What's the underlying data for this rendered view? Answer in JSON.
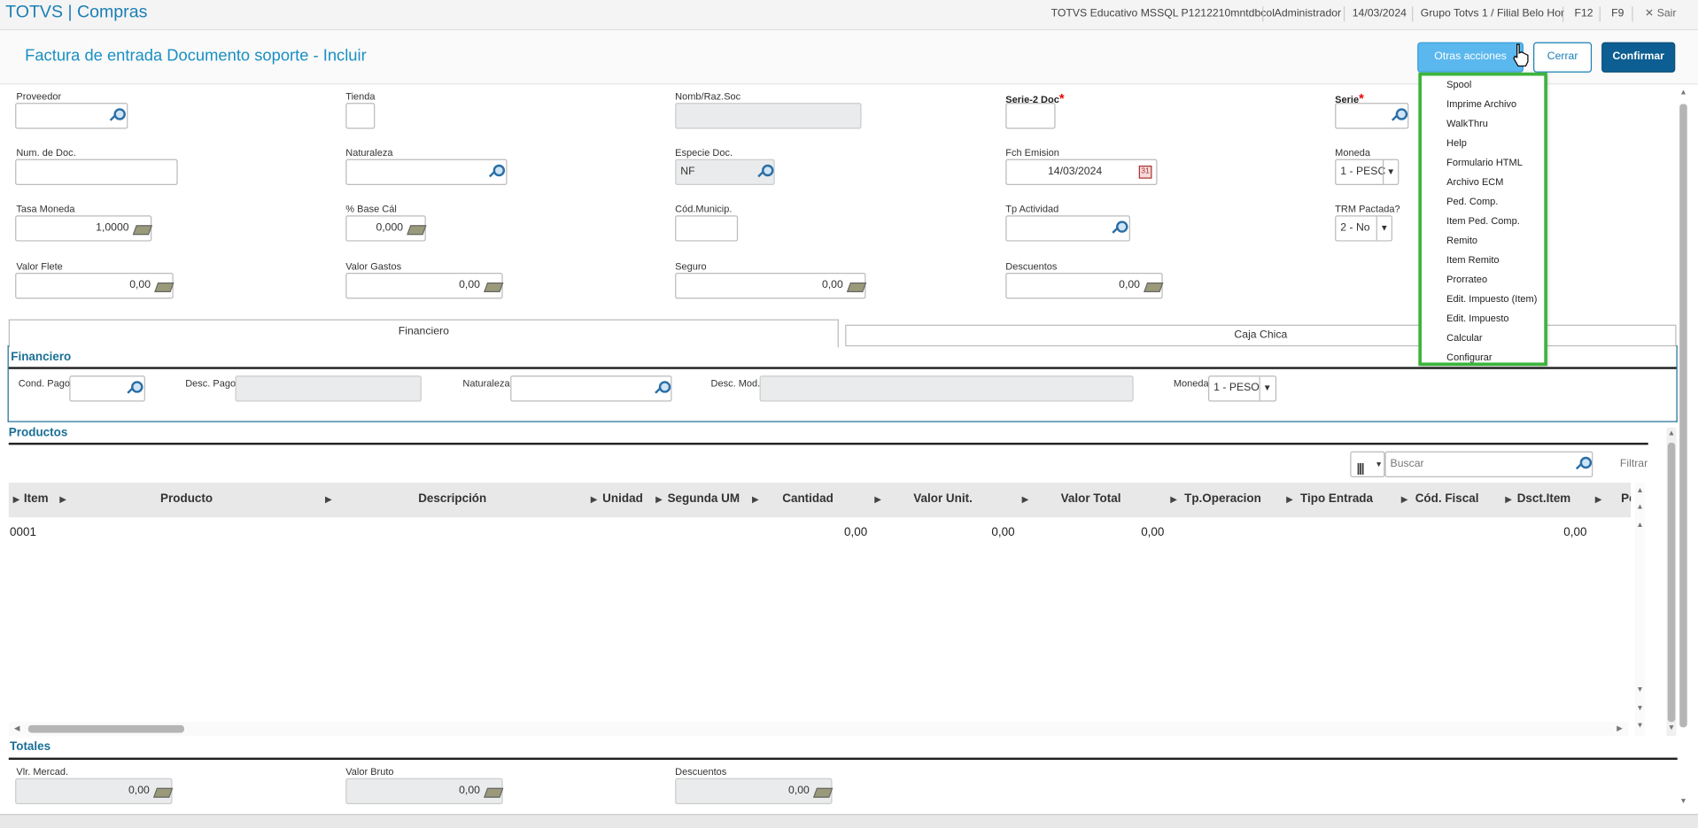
{
  "app": {
    "brand": "TOTVS | Compras",
    "environment": "TOTVS Educativo MSSQL P1212210mntdbcol",
    "user": "Administrador",
    "date": "14/03/2024",
    "branch": "Grupo Totvs 1 / Filial Belo Hor",
    "f12": "F12",
    "f9": "F9",
    "exit_label": "Sair"
  },
  "header": {
    "title": "Factura de entrada Documento soporte - Incluir",
    "otras": "Otras acciones",
    "cerrar": "Cerrar",
    "confirmar": "Confirmar"
  },
  "form": {
    "proveedor": "Proveedor",
    "tienda": "Tienda",
    "nomb": "Nomb/Raz.Soc",
    "serie2": "Serie-2 Doc",
    "serie": "Serie",
    "numdoc": "Num. de Doc.",
    "naturaleza": "Naturaleza",
    "especie": "Especie Doc.",
    "especie_val": "NF",
    "fch": "Fch Emision",
    "fch_val": "14/03/2024",
    "moneda": "Moneda",
    "moneda_val": "1 - PESC",
    "tasa": "Tasa Moneda",
    "tasa_val": "1,0000",
    "base": "% Base Cál",
    "base_val": "0,000",
    "codmun": "Cód.Municip.",
    "tpact": "Tp Actividad",
    "trm": "TRM Pactada?",
    "trm_val": "2 - No",
    "flete": "Valor Flete",
    "flete_val": "0,00",
    "gastos": "Valor Gastos",
    "gastos_val": "0,00",
    "seguro": "Seguro",
    "seguro_val": "0,00",
    "desc": "Descuentos",
    "desc_val": "0,00"
  },
  "tabs": {
    "financiero": "Financiero",
    "caja": "Caja Chica"
  },
  "fin": {
    "title": "Financiero",
    "cond": "Cond. Pago",
    "descpago": "Desc. Pago",
    "nat": "Naturaleza",
    "descmod": "Desc. Mod.",
    "moneda": "Moneda",
    "moneda_val": "1 - PESO"
  },
  "prod": {
    "title": "Productos",
    "search_placeholder": "Buscar",
    "filter": "Filtrar",
    "cols": [
      "Item",
      "Producto",
      "Descripción",
      "Unidad",
      "Segunda UM",
      "Cantidad",
      "Valor Unit.",
      "Valor Total",
      "Tp.Operacion",
      "Tipo Entrada",
      "Cód. Fiscal",
      "Dsct.Item",
      "Pe"
    ],
    "row": {
      "item": "0001",
      "cantidad": "0,00",
      "unit": "0,00",
      "total": "0,00",
      "dsct": "0,00"
    }
  },
  "totales": {
    "title": "Totales",
    "merc": "Vlr. Mercad.",
    "merc_val": "0,00",
    "bruto": "Valor Bruto",
    "bruto_val": "0,00",
    "desc": "Descuentos",
    "desc_val": "0,00"
  },
  "menu": [
    "Spool",
    "Imprime Archivo",
    "WalkThru",
    "Help",
    "Formulario HTML",
    "Archivo ECM",
    "Ped. Comp.",
    "Item Ped. Comp.",
    "Remito",
    "Item Remito",
    "Prorrateo",
    "Edit. Impuesto (Item)",
    "Edit. Impuesto",
    "Calcular",
    "Configurar"
  ]
}
